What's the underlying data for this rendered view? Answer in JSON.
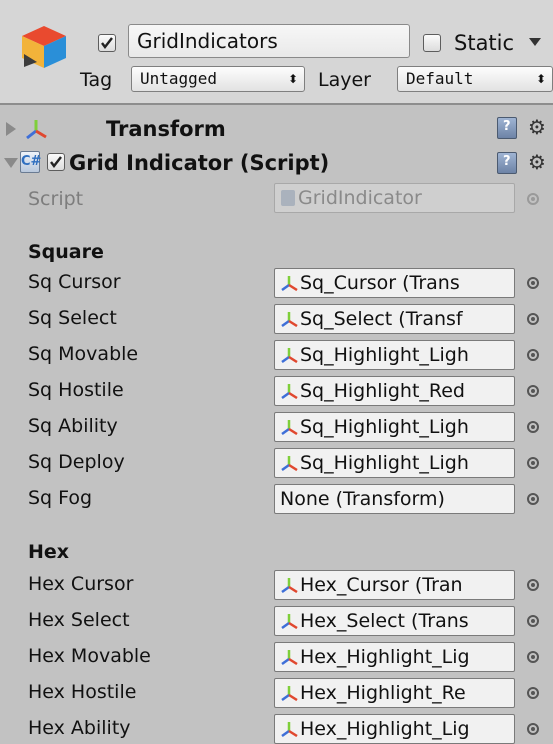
{
  "header": {
    "active": true,
    "name": "GridIndicators",
    "static_label": "Static",
    "tag_label": "Tag",
    "tag_value": "Untagged",
    "layer_label": "Layer",
    "layer_value": "Default"
  },
  "transform": {
    "title": "Transform",
    "expanded": false
  },
  "script_component": {
    "title": "Grid Indicator (Script)",
    "expanded": true,
    "enabled": true,
    "script_label": "Script",
    "script_value": "GridIndicator"
  },
  "square": {
    "heading": "Square",
    "fields": [
      {
        "label": "Sq Cursor",
        "value": "Sq_Cursor (Trans"
      },
      {
        "label": "Sq Select",
        "value": "Sq_Select (Transf"
      },
      {
        "label": "Sq Movable",
        "value": "Sq_Highlight_Ligh"
      },
      {
        "label": "Sq Hostile",
        "value": "Sq_Highlight_Red"
      },
      {
        "label": "Sq Ability",
        "value": "Sq_Highlight_Ligh"
      },
      {
        "label": "Sq Deploy",
        "value": "Sq_Highlight_Ligh"
      },
      {
        "label": "Sq Fog",
        "value": "None (Transform)"
      }
    ]
  },
  "hex": {
    "heading": "Hex",
    "fields": [
      {
        "label": "Hex Cursor",
        "value": "Hex_Cursor (Tran"
      },
      {
        "label": "Hex Select",
        "value": "Hex_Select (Trans"
      },
      {
        "label": "Hex Movable",
        "value": "Hex_Highlight_Lig"
      },
      {
        "label": "Hex Hostile",
        "value": "Hex_Highlight_Re"
      },
      {
        "label": "Hex Ability",
        "value": "Hex_Highlight_Lig"
      }
    ]
  },
  "icons": {
    "gameobject": "cube-icon",
    "transform": "transform-axes-icon",
    "script": "csharp-script-icon",
    "help": "help-book-icon",
    "settings": "gear-icon",
    "picker": "object-picker-icon"
  },
  "colors": {
    "header_bg": "#d6d6d6",
    "panel_bg": "#c2c2c2",
    "axis_red": "#e0482f",
    "axis_green": "#7fcf3a",
    "axis_blue": "#3e6fd8"
  }
}
